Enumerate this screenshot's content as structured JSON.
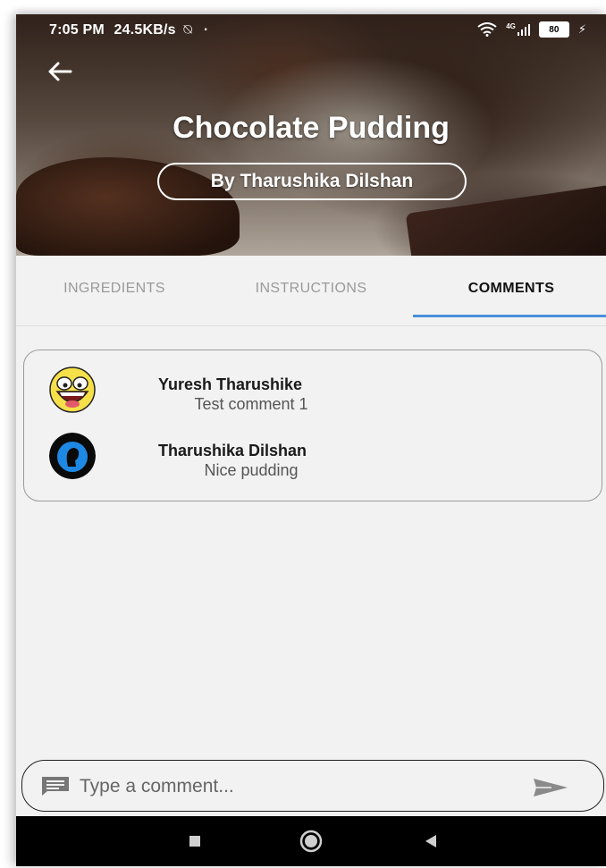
{
  "status_bar": {
    "time": "7:05 PM",
    "speed": "24.5KB/s",
    "network": "4G",
    "battery": "80"
  },
  "recipe": {
    "title": "Chocolate Pudding",
    "author": "By Tharushika Dilshan"
  },
  "tabs": [
    {
      "label": "INGREDIENTS",
      "active": false
    },
    {
      "label": "INSTRUCTIONS",
      "active": false
    },
    {
      "label": "COMMENTS",
      "active": true
    }
  ],
  "comments": [
    {
      "author": "Yuresh Tharushike",
      "text": "Test comment 1",
      "avatar": "laughing-face-icon"
    },
    {
      "author": "Tharushika Dilshan",
      "text": "Nice pudding",
      "avatar": "user-silhouette-icon"
    }
  ],
  "comment_box": {
    "placeholder": "Type a comment...",
    "value": ""
  },
  "icons": {
    "back": "arrow-left-icon",
    "message": "message-icon",
    "send": "send-icon",
    "nav": [
      "square-icon",
      "circle-icon",
      "triangle-back-icon"
    ]
  },
  "colors": {
    "accent": "#4a90d9",
    "avatar_yellow": "#f5e04a",
    "avatar_blue": "#1e88e5"
  }
}
